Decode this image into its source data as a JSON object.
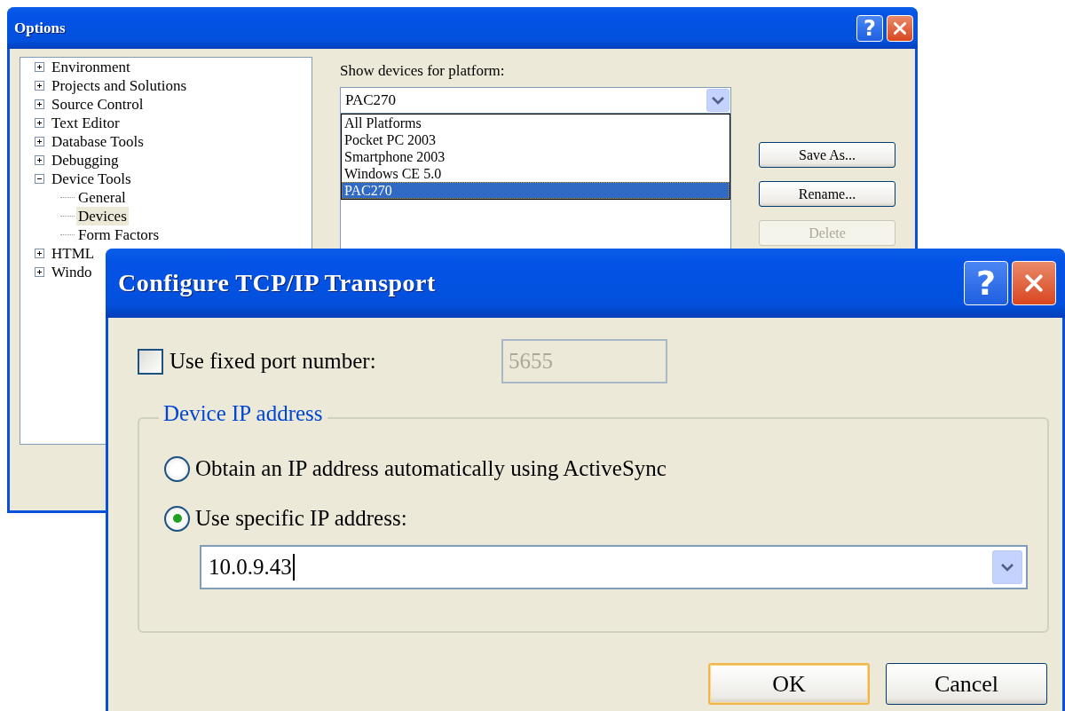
{
  "options_window": {
    "title": "Options",
    "help_button": "?",
    "tree": [
      {
        "label": "Environment",
        "expanded": false,
        "selected": false
      },
      {
        "label": "Projects and Solutions",
        "expanded": false,
        "selected": false
      },
      {
        "label": "Source Control",
        "expanded": false,
        "selected": false
      },
      {
        "label": "Text Editor",
        "expanded": false,
        "selected": false
      },
      {
        "label": "Database Tools",
        "expanded": false,
        "selected": false
      },
      {
        "label": "Debugging",
        "expanded": false,
        "selected": false
      },
      {
        "label": "Device Tools",
        "expanded": true,
        "selected": false,
        "children": [
          {
            "label": "General",
            "selected": false
          },
          {
            "label": "Devices",
            "selected": true
          },
          {
            "label": "Form Factors",
            "selected": false
          }
        ]
      },
      {
        "label": "HTML",
        "expanded": false,
        "selected": false
      },
      {
        "label": "Windo",
        "expanded": false,
        "selected": false
      }
    ],
    "platform_label": "Show devices for platform:",
    "platform_combo": {
      "value": "PAC270"
    },
    "platform_dropdown": [
      {
        "label": "All Platforms",
        "selected": false
      },
      {
        "label": "Pocket PC 2003",
        "selected": false
      },
      {
        "label": "Smartphone 2003",
        "selected": false
      },
      {
        "label": "Windows CE 5.0",
        "selected": false
      },
      {
        "label": "PAC270",
        "selected": true
      }
    ],
    "buttons": [
      {
        "label": "Save As...",
        "disabled": false
      },
      {
        "label": "Rename...",
        "disabled": false
      },
      {
        "label": "Delete",
        "disabled": true
      }
    ]
  },
  "tcp_dialog": {
    "title": "Configure TCP/IP Transport",
    "help_button": "?",
    "fixed_port": {
      "label": "Use fixed port number:",
      "checked": false
    },
    "port_field": {
      "value": "5655",
      "disabled": true
    },
    "group": {
      "title": "Device IP address",
      "options": [
        {
          "label": "Obtain an IP address automatically using ActiveSync",
          "selected": false
        },
        {
          "label": "Use specific IP address:",
          "selected": true
        }
      ],
      "ip_combo": {
        "value": "10.0.9.43"
      }
    },
    "buttons": [
      {
        "label": "OK",
        "default": true
      },
      {
        "label": "Cancel",
        "default": false
      }
    ]
  }
}
